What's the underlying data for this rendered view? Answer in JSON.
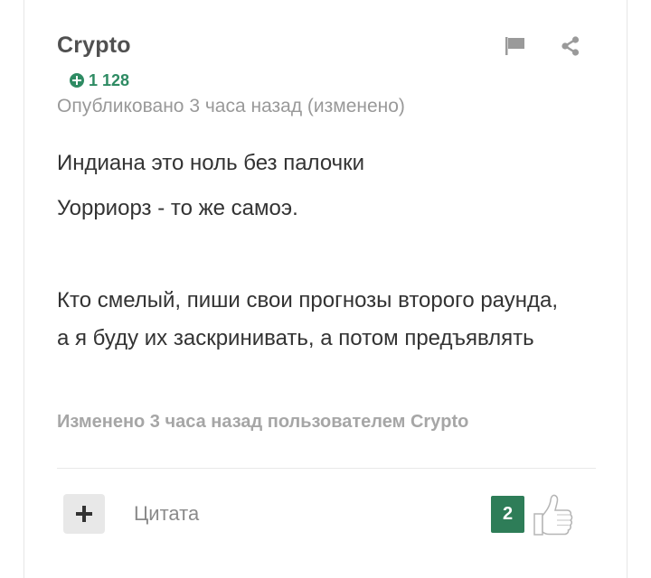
{
  "post": {
    "author": "Crypto",
    "reputation": "1 128",
    "published": "Опубликовано 3 часа назад (изменено)",
    "content": {
      "line1": "Индиана это ноль без палочки",
      "line2": "Уорриорз - то же самоэ.",
      "line3": "Кто смелый, пиши свои прогнозы второго раунда, а я буду их заскринивать, а потом предъявлять"
    },
    "edited_note": "Изменено 3 часа назад пользователем Crypto"
  },
  "footer": {
    "quote_label": "Цитата",
    "likes_count": "2"
  },
  "icons": {
    "flag": "flag-icon",
    "share": "share-icon",
    "plus": "plus-icon",
    "thumbs_up": "thumbs-up-icon",
    "reputation": "plus-circle-icon"
  },
  "colors": {
    "accent_green": "#2e8b63",
    "like_badge": "#2e7d58",
    "muted_text": "#999999"
  }
}
